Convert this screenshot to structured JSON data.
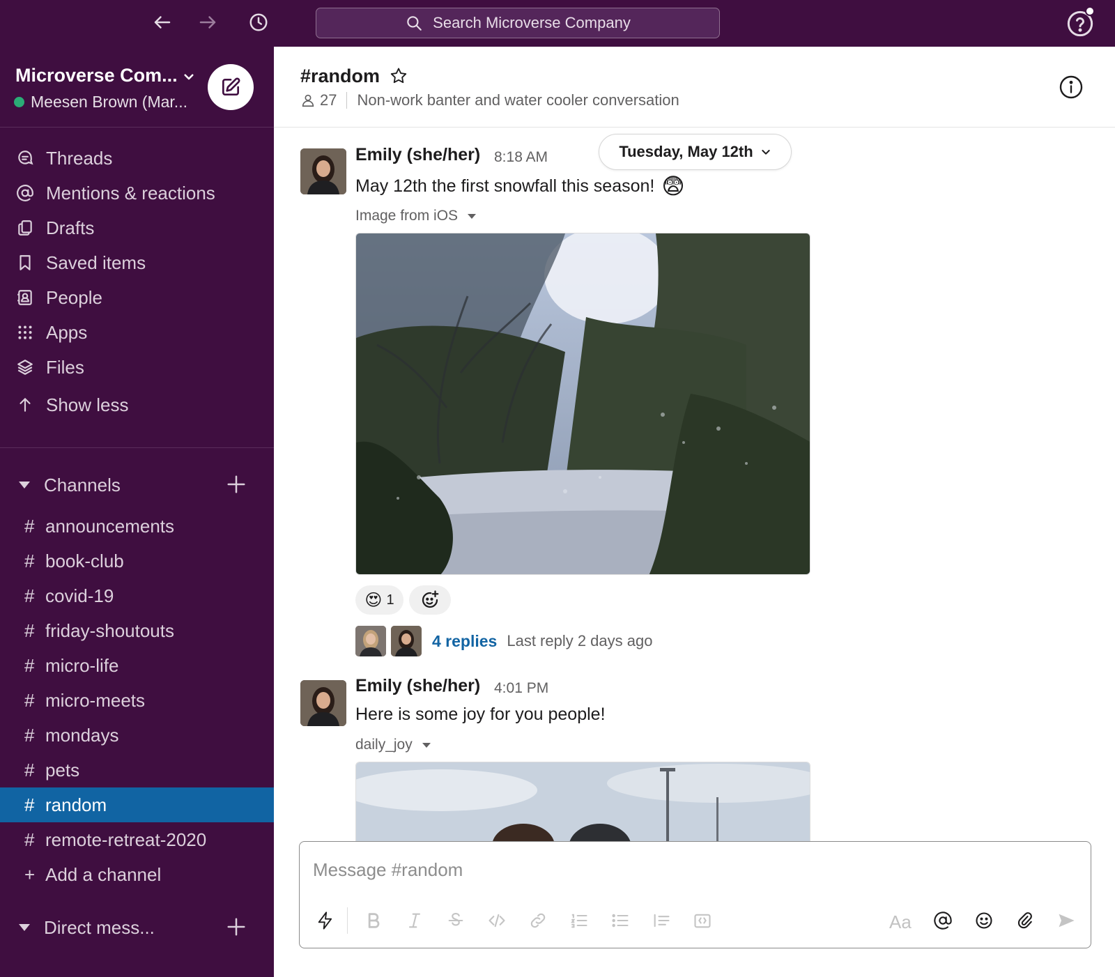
{
  "topbar": {
    "search_placeholder": "Search Microverse Company",
    "icons": [
      "back-arrow-icon",
      "forward-arrow-icon",
      "history-icon",
      "search-icon",
      "help-icon"
    ]
  },
  "workspace": {
    "name": "Microverse Com...",
    "user": "Meesen Brown (Mar..."
  },
  "sidebar": {
    "nav": [
      {
        "label": "Threads",
        "icon": "threads-icon"
      },
      {
        "label": "Mentions & reactions",
        "icon": "at-sign-icon"
      },
      {
        "label": "Drafts",
        "icon": "drafts-icon"
      },
      {
        "label": "Saved items",
        "icon": "bookmark-icon"
      },
      {
        "label": "People",
        "icon": "people-icon"
      },
      {
        "label": "Apps",
        "icon": "apps-grid-icon"
      },
      {
        "label": "Files",
        "icon": "files-stack-icon"
      },
      {
        "label": "Show less",
        "icon": "arrow-up-icon"
      }
    ],
    "channels_heading": "Channels",
    "channels": [
      {
        "name": "announcements"
      },
      {
        "name": "book-club"
      },
      {
        "name": "covid-19"
      },
      {
        "name": "friday-shoutouts"
      },
      {
        "name": "micro-life"
      },
      {
        "name": "micro-meets"
      },
      {
        "name": "mondays"
      },
      {
        "name": "pets"
      },
      {
        "name": "random",
        "active": true
      },
      {
        "name": "remote-retreat-2020"
      }
    ],
    "hash_symbol": "#",
    "plus_symbol": "+",
    "add_channel": "Add a channel",
    "dm_heading": "Direct mess..."
  },
  "channel": {
    "title": "#random",
    "member_count": "27",
    "topic": "Non-work banter and water cooler conversation"
  },
  "date_divider": "Tuesday, May 12th",
  "messages": [
    {
      "author": "Emily (she/her)",
      "time": "8:18 AM",
      "text": "May 12th the first snowfall this season!",
      "emoji": "😨",
      "attachment_label": "Image from iOS",
      "reactions": [
        {
          "emoji": "😍",
          "count": "1"
        }
      ],
      "replies": "4 replies",
      "last_reply": "Last reply 2 days ago"
    },
    {
      "author": "Emily (she/her)",
      "time": "4:01 PM",
      "text": "Here is some joy for you people!",
      "attachment_label": "daily_joy"
    }
  ],
  "composer": {
    "placeholder": "Message #random",
    "aa_label": "Aa"
  },
  "colors": {
    "sidebar_bg": "#3f0e40",
    "active_channel": "#1164a3",
    "link": "#1264a3",
    "presence": "#2bac76"
  }
}
